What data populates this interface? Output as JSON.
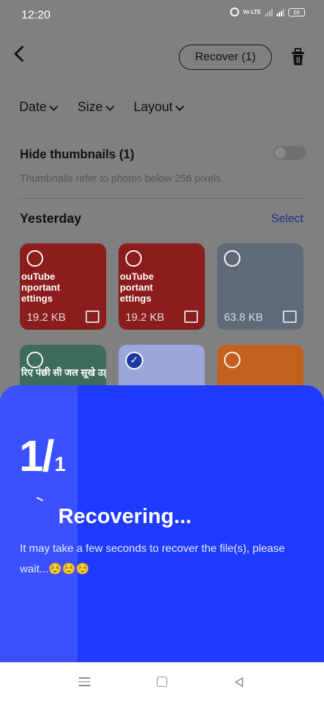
{
  "status_bar": {
    "time": "12:20",
    "network": "Vo LTE",
    "battery": "69"
  },
  "header": {
    "recover_label": "Recover (1)"
  },
  "filters": [
    "Date",
    "Size",
    "Layout"
  ],
  "hide_thumbnails": {
    "title": "Hide thumbnails (1)",
    "subtitle": "Thumbnails refer to photos below 256 pixels."
  },
  "section": {
    "title": "Yesterday",
    "select_label": "Select"
  },
  "thumbnails": [
    {
      "size": "19.2 KB",
      "caption": "ouTube\nnportant\nettings",
      "selected": false,
      "color": "#8c1d1d"
    },
    {
      "size": "19.2 KB",
      "caption": "ouTube\nportant\nettings",
      "selected": false,
      "color": "#8c1d1d"
    },
    {
      "size": "63.8 KB",
      "caption": "",
      "selected": false,
      "color": "#5e6a78"
    },
    {
      "size": "",
      "caption": "रिए पंछी सी जल सूखे उड़",
      "selected": false,
      "color": "#3d6b5e"
    },
    {
      "size": "",
      "caption": "",
      "selected": true,
      "color": "#9aa7d8"
    },
    {
      "size": "",
      "caption": "",
      "selected": false,
      "color": "#c2601e"
    }
  ],
  "progress": {
    "current": "1",
    "total": "1",
    "title": "Recovering...",
    "message": "It may take a few seconds to recover the file(s), please wait...☺️☺️☺️"
  },
  "colors": {
    "sheet": "#1f3bff",
    "sheet_left": "#3b50ff",
    "accent": "#1a2e8a"
  }
}
